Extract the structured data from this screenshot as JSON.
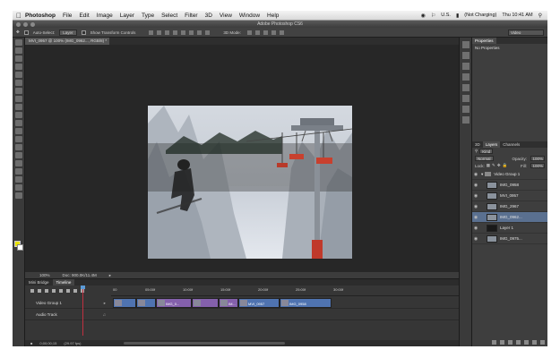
{
  "menubar": {
    "app_name": "Photoshop",
    "items": [
      "File",
      "Edit",
      "Image",
      "Layer",
      "Type",
      "Select",
      "Filter",
      "3D",
      "View",
      "Window",
      "Help"
    ],
    "status": {
      "input_source": "U.S.",
      "battery_text": "(Not Charging)",
      "clock": "Thu 10:41 AM"
    }
  },
  "window": {
    "title": "Adobe Photoshop CS6"
  },
  "options_bar": {
    "auto_select_label": "Auto-Select:",
    "auto_select_value": "Layer",
    "show_transform_label": "Show Transform Controls",
    "mode_3d_label": "3D Mode:",
    "workspace": "Video"
  },
  "document": {
    "tab_title": "MVI_0957 @ 100% (IMG_0962..., RGB/8) *",
    "zoom": "100%",
    "doc_size": "Doc: 900.0K/11.4M"
  },
  "properties_panel": {
    "tabs": [
      "Properties"
    ],
    "content": "No Properties"
  },
  "layers_panel": {
    "tabs": [
      "3D",
      "Layers",
      "Channels"
    ],
    "filter_kind": "Kind",
    "blend_mode": "Normal",
    "opacity_label": "Opacity:",
    "opacity_value": "100%",
    "lock_label": "Lock:",
    "fill_label": "Fill:",
    "fill_value": "100%",
    "group_name": "Video Group 1",
    "layers": [
      "IMG_0958",
      "MVI_0957",
      "IMG_2967",
      "IMG_0962...",
      "Layer 1",
      "IMG_0975..."
    ],
    "selected_layer": "IMG_0962..."
  },
  "timeline": {
    "tabs": [
      "Mini Bridge",
      "Timeline"
    ],
    "active_tab": "Timeline",
    "ruler": [
      "00",
      "05:00f",
      "10:00f",
      "15:00f",
      "20:00f",
      "25:00f",
      "30:00f"
    ],
    "tracks": [
      {
        "name": "Video Group 1",
        "clips": [
          {
            "label": "",
            "color": "#4f73b0"
          },
          {
            "label": "",
            "color": "#4f73b0"
          },
          {
            "label": "IMG_0...",
            "color": "#8460ac"
          },
          {
            "label": "",
            "color": "#8460ac"
          },
          {
            "label": "IM...",
            "color": "#8460ac"
          },
          {
            "label": "MVI_0957",
            "color": "#4f73b0"
          },
          {
            "label": "IMG_0958",
            "color": "#4f73b0"
          }
        ]
      },
      {
        "name": "Audio Track",
        "clips": []
      }
    ],
    "timecode": "0;00;00;15",
    "fps": "(29.97 fps)"
  }
}
